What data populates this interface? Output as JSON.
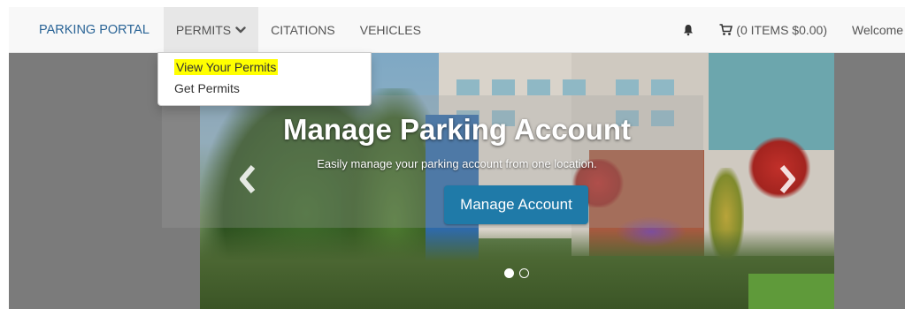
{
  "nav": {
    "brand": "PARKING PORTAL",
    "items": [
      {
        "label": "PERMITS",
        "has_dropdown": true,
        "active": true
      },
      {
        "label": "CITATIONS"
      },
      {
        "label": "VEHICLES"
      }
    ],
    "cart_label": "(0 ITEMS $0.00)",
    "welcome": "Welcome",
    "icons": {
      "bell": "bell-icon",
      "cart": "cart-icon",
      "chevron": "chevron-down-icon"
    }
  },
  "dropdown": {
    "items": [
      {
        "label": "View Your Permits",
        "highlighted": true
      },
      {
        "label": "Get Permits"
      }
    ]
  },
  "hero": {
    "title": "Manage Parking Account",
    "subtitle": "Easily manage your parking account from one location.",
    "button_label": "Manage Account",
    "slides": 2,
    "active_slide": 1
  },
  "colors": {
    "brand_link": "#2a6496",
    "button": "#1f7aa8",
    "highlight": "#ffff00",
    "navbar_bg": "#f8f8f8"
  }
}
